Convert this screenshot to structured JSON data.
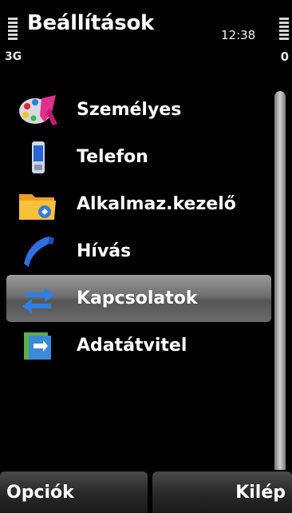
{
  "status_bar": {
    "title": "Beállítások",
    "network": "3G",
    "clock": "12:38",
    "battery_level": "0"
  },
  "settings_list": {
    "items": [
      {
        "label": "Személyes",
        "icon": "personal-paint-palette-icon",
        "selected": false
      },
      {
        "label": "Telefon",
        "icon": "phone-device-icon",
        "selected": false
      },
      {
        "label": "Alkalmaz.kezelő",
        "icon": "app-manager-folder-icon",
        "selected": false
      },
      {
        "label": "Hívás",
        "icon": "call-handset-icon",
        "selected": false
      },
      {
        "label": "Kapcsolatok",
        "icon": "connectivity-arrows-icon",
        "selected": true
      },
      {
        "label": "Adatátvitel",
        "icon": "data-transfer-icon",
        "selected": false
      }
    ]
  },
  "softkeys": {
    "left": "Opciók",
    "right": "Kilép"
  },
  "colors": {
    "background": "#000000",
    "selection": "#6e6e6e",
    "text": "#ffffff"
  }
}
